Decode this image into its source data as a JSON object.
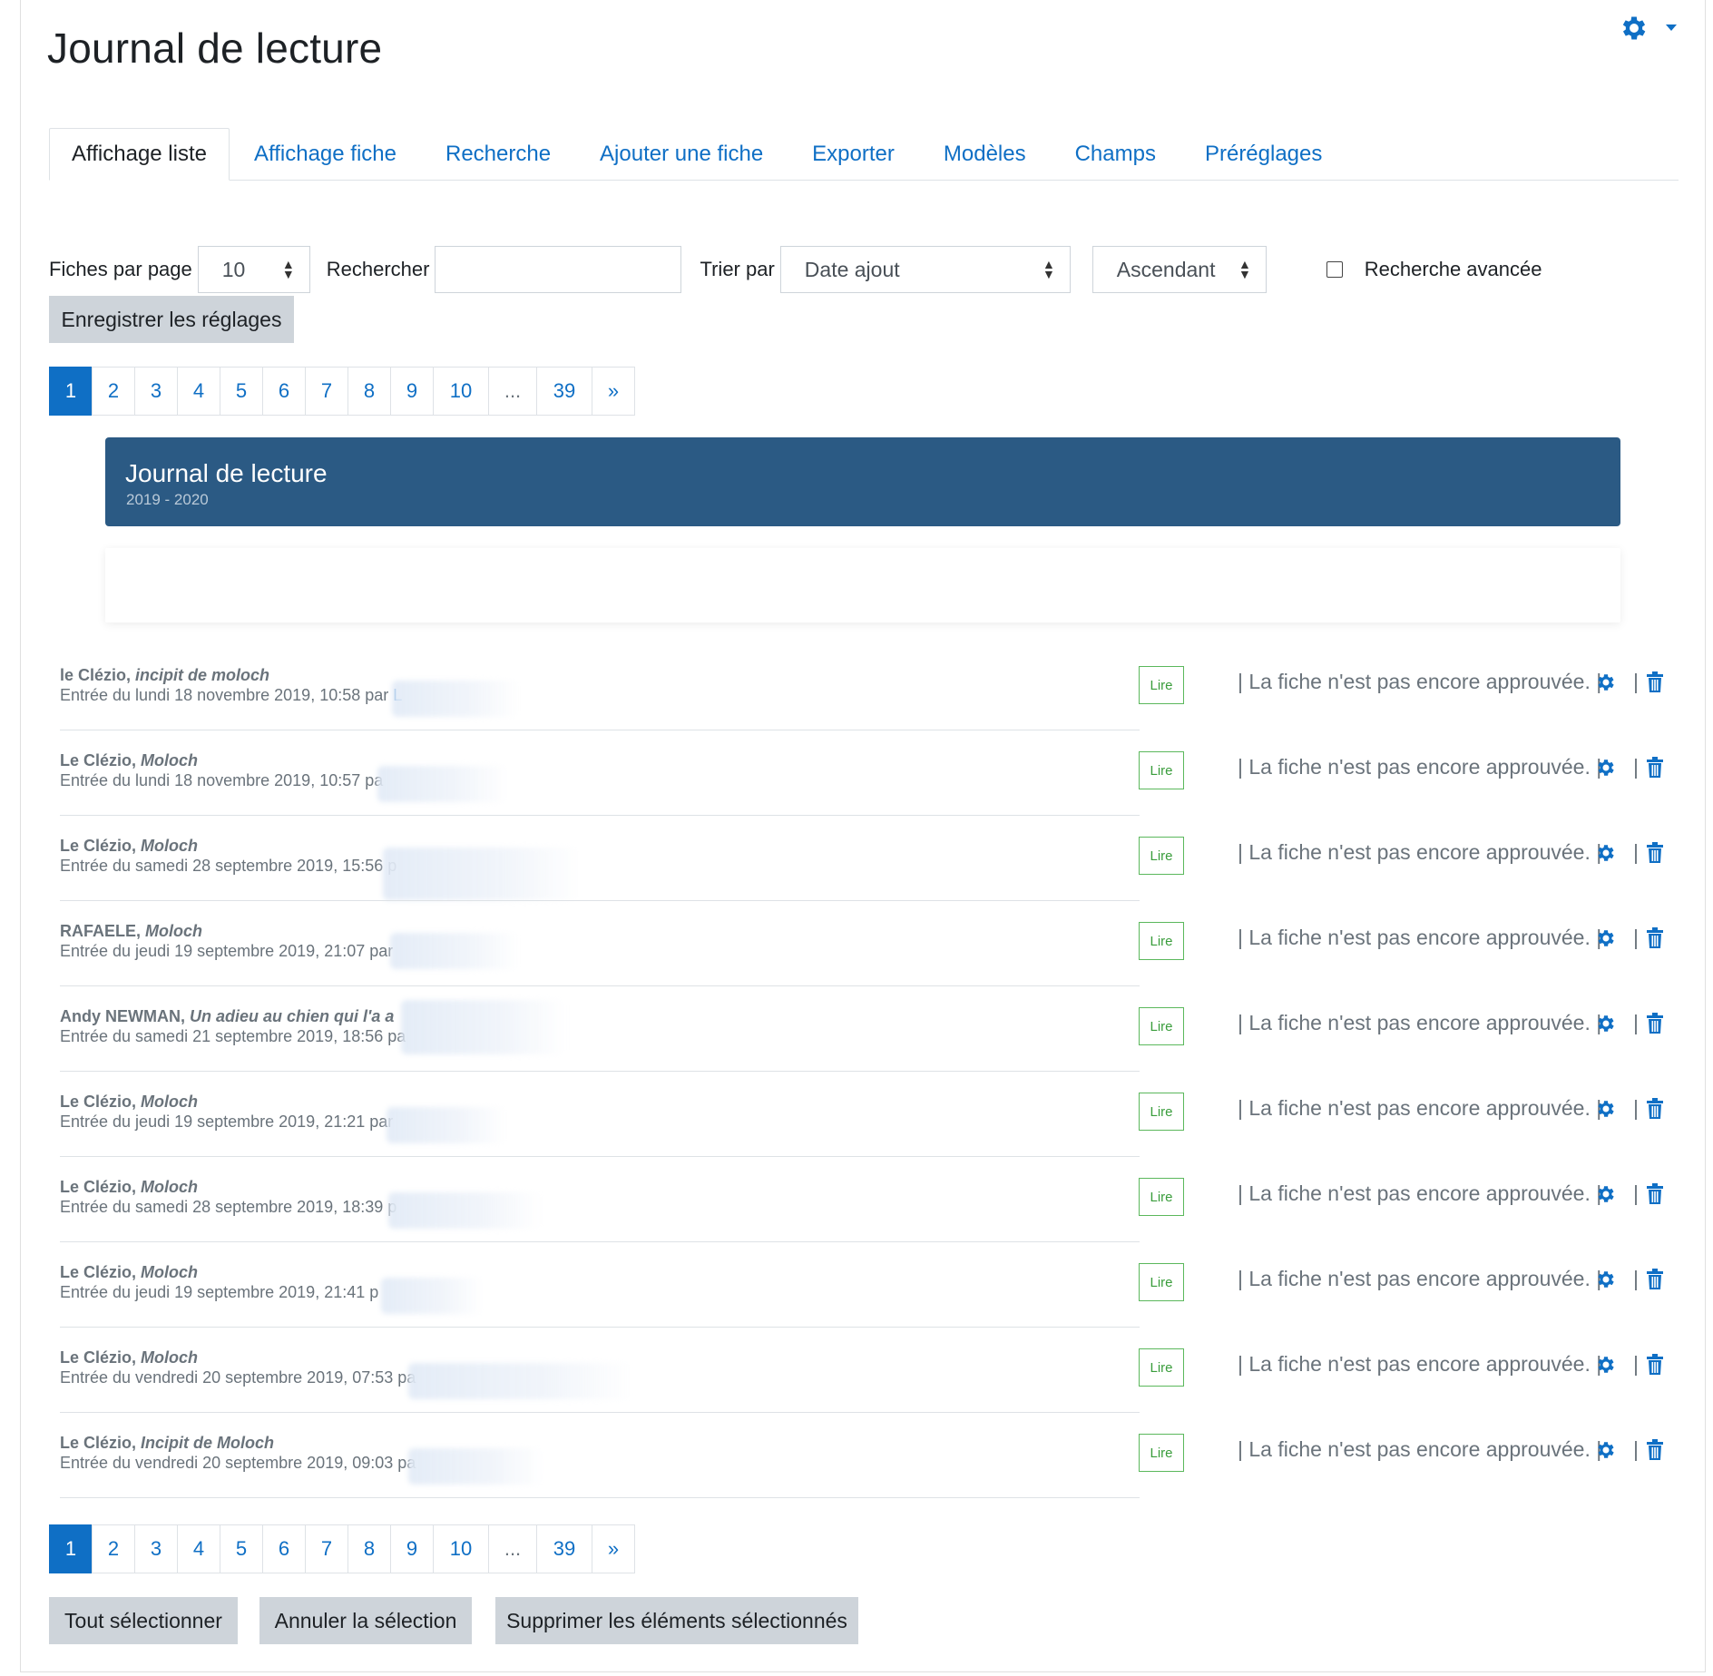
{
  "page": {
    "title": "Journal de lecture"
  },
  "tabs": [
    {
      "label": "Affichage liste",
      "active": true
    },
    {
      "label": "Affichage fiche"
    },
    {
      "label": "Recherche"
    },
    {
      "label": "Ajouter une fiche"
    },
    {
      "label": "Exporter"
    },
    {
      "label": "Modèles"
    },
    {
      "label": "Champs"
    },
    {
      "label": "Préréglages"
    }
  ],
  "settings": {
    "per_page_label": "Fiches par page",
    "per_page_value": "10",
    "search_label": "Rechercher",
    "search_value": "",
    "sort_label": "Trier par",
    "sort_value": "Date ajout",
    "order_value": "Ascendant",
    "advanced_label": "Recherche avancée",
    "advanced_checked": false,
    "save_button": "Enregistrer les réglages"
  },
  "pagination": {
    "pages": [
      "1",
      "2",
      "3",
      "4",
      "5",
      "6",
      "7",
      "8",
      "9",
      "10",
      "...",
      "39",
      "»"
    ],
    "current": "1"
  },
  "banner": {
    "title": "Journal de lecture",
    "subtitle": "2019 - 2020"
  },
  "entries": [
    {
      "author": "le Clézio,",
      "book": "incipit de moloch",
      "meta": "Entrée du lundi 18 novembre 2019, 10:58 par",
      "extra": "L"
    },
    {
      "author": "Le Clézio,",
      "book": "Moloch",
      "meta": "Entrée du lundi 18 novembre 2019, 10:57 pa",
      "extra": ""
    },
    {
      "author": "Le Clézio,",
      "book": "Moloch",
      "meta": "Entrée du samedi 28 septembre 2019, 15:56 p",
      "extra": ""
    },
    {
      "author": "RAFAELE,",
      "book": "Moloch",
      "meta": "Entrée du jeudi 19 septembre 2019, 21:07 par",
      "extra": ""
    },
    {
      "author": "Andy NEWMAN,",
      "book": "Un adieu au chien qui l'a a",
      "meta": "Entrée du samedi 21 septembre 2019, 18:56 pa",
      "extra": ""
    },
    {
      "author": "Le Clézio,",
      "book": "Moloch",
      "meta": "Entrée du jeudi 19 septembre 2019, 21:21 par",
      "extra": ""
    },
    {
      "author": "Le Clézio,",
      "book": "Moloch",
      "meta": "Entrée du samedi 28 septembre 2019, 18:39 p",
      "extra": ""
    },
    {
      "author": "Le Clézio,",
      "book": "Moloch",
      "meta": "Entrée du jeudi 19 septembre 2019, 21:41 p",
      "extra": ""
    },
    {
      "author": "Le Clézio,",
      "book": "Moloch",
      "meta": "Entrée du vendredi 20 septembre 2019, 07:53 pa",
      "extra": ""
    },
    {
      "author": "Le Clézio,",
      "book": "Incipit de Moloch",
      "meta": "Entrée du vendredi 20 septembre 2019, 09:03 pa",
      "extra": ""
    }
  ],
  "entry_common": {
    "read_button": "Lire",
    "status": "| La fiche n'est pas encore approuvée. |",
    "pipe": "|"
  },
  "bulk": {
    "select_all": "Tout sélectionner",
    "deselect": "Annuler la sélection",
    "delete_selected": "Supprimer les éléments sélectionnés"
  },
  "colors": {
    "accent": "#0f6fc5",
    "banner": "#2b5a84",
    "read_green": "#5bb85c",
    "muted": "#6a737b"
  },
  "icons": {
    "settings": "gear-icon",
    "menu": "caret-down-icon",
    "edit": "gear-icon",
    "delete": "trash-icon"
  }
}
